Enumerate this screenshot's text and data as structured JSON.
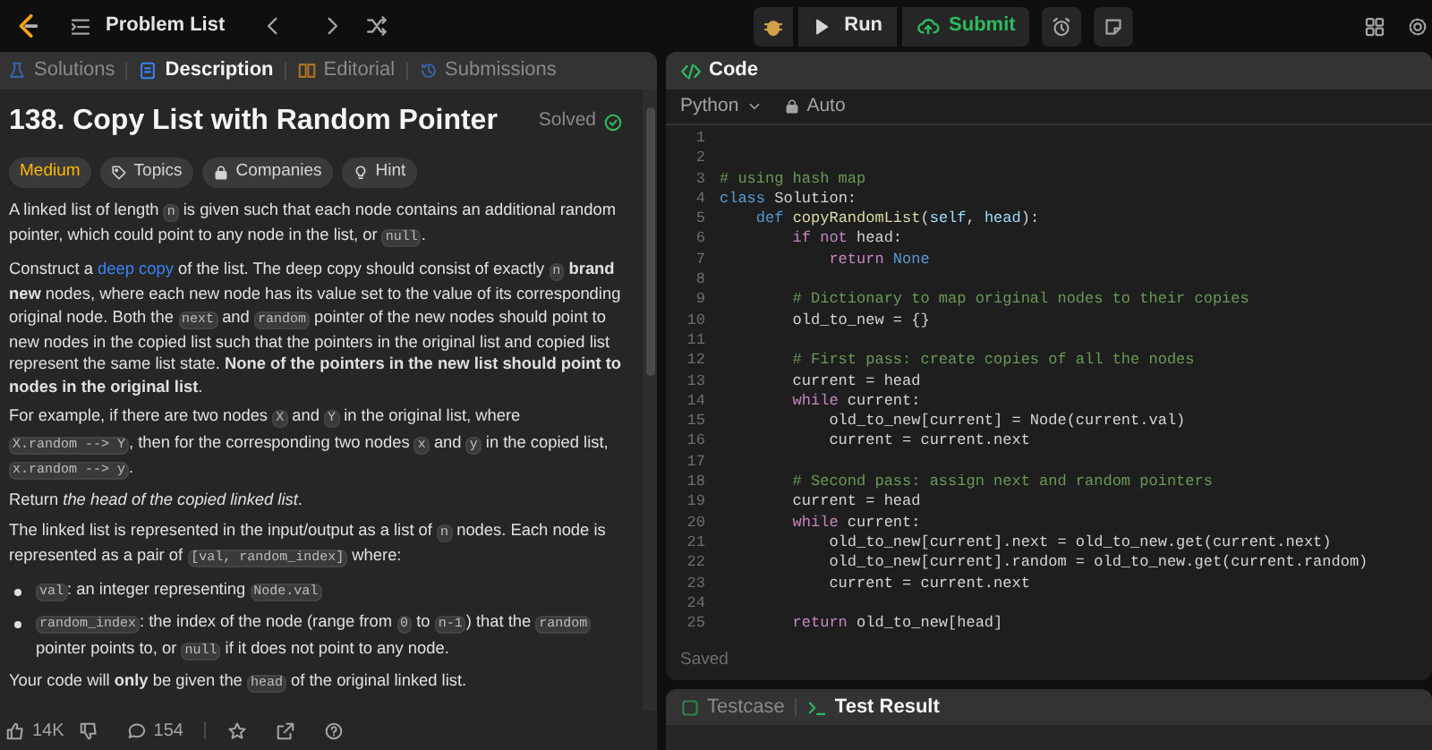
{
  "topbar": {
    "nav_label": "Problem List",
    "run_label": "Run",
    "submit_label": "Submit"
  },
  "left_tabs": [
    {
      "label": "Solutions",
      "selected": false
    },
    {
      "label": "Description",
      "selected": true
    },
    {
      "label": "Editorial",
      "selected": false
    },
    {
      "label": "Submissions",
      "selected": false
    }
  ],
  "problem": {
    "title": "138. Copy List with Random Pointer",
    "status": "Solved",
    "tags": [
      {
        "label": "Medium",
        "kind": "difficulty"
      },
      {
        "label": "Topics",
        "kind": "topics"
      },
      {
        "label": "Companies",
        "kind": "companies"
      },
      {
        "label": "Hint",
        "kind": "hint"
      }
    ],
    "blocks": [
      {
        "kind": "para",
        "segments": [
          {
            "kind": "text",
            "text": "A linked list of length "
          },
          {
            "kind": "code",
            "text": "n"
          },
          {
            "kind": "text",
            "text": " is given such that each node contains an additional random pointer, which could point to any node in the list, or "
          },
          {
            "kind": "code",
            "text": "null"
          },
          {
            "kind": "text",
            "text": "."
          }
        ]
      },
      {
        "kind": "para",
        "segments": [
          {
            "kind": "text",
            "text": "Construct a "
          },
          {
            "kind": "link",
            "text": "deep copy"
          },
          {
            "kind": "text",
            "text": " of the list. The deep copy should consist of exactly "
          },
          {
            "kind": "code",
            "text": "n"
          },
          {
            "kind": "text",
            "text": " **brand new** nodes, where each new node has its value set to the value of its corresponding original node. Both the "
          },
          {
            "kind": "code",
            "text": "next"
          },
          {
            "kind": "text",
            "text": " and "
          },
          {
            "kind": "code",
            "text": "random"
          },
          {
            "kind": "text",
            "text": " pointer of the new nodes should point to new nodes in the copied list such that the pointers in the original list and copied list represent the same list state. **None of the pointers in the new list should point to nodes in the original list**."
          }
        ]
      },
      {
        "kind": "para",
        "segments": [
          {
            "kind": "text",
            "text": "For example, if there are two nodes "
          },
          {
            "kind": "code",
            "text": "X"
          },
          {
            "kind": "text",
            "text": " and "
          },
          {
            "kind": "code",
            "text": "Y"
          },
          {
            "kind": "text",
            "text": " in the original list, where "
          },
          {
            "kind": "code",
            "text": "X.random --> Y"
          },
          {
            "kind": "text",
            "text": ", then for the corresponding two nodes "
          },
          {
            "kind": "code",
            "text": "x"
          },
          {
            "kind": "text",
            "text": " and "
          },
          {
            "kind": "code",
            "text": "y"
          },
          {
            "kind": "text",
            "text": " in the copied list, "
          },
          {
            "kind": "code",
            "text": "x.random --> y"
          },
          {
            "kind": "text",
            "text": "."
          }
        ]
      },
      {
        "kind": "para",
        "segments": [
          {
            "kind": "text",
            "text": "Return *the head of the copied linked list*."
          }
        ]
      },
      {
        "kind": "para",
        "segments": [
          {
            "kind": "text",
            "text": "The linked list is represented in the input/output as a list of "
          },
          {
            "kind": "code",
            "text": "n"
          },
          {
            "kind": "text",
            "text": " nodes. Each node is represented as a pair of "
          },
          {
            "kind": "code",
            "text": "[val, random_index]"
          },
          {
            "kind": "text",
            "text": " where:"
          }
        ]
      },
      {
        "kind": "bullet",
        "segments": [
          {
            "kind": "code",
            "text": "val"
          },
          {
            "kind": "text",
            "text": ": an integer representing "
          },
          {
            "kind": "code",
            "text": "Node.val"
          }
        ]
      },
      {
        "kind": "bullet",
        "segments": [
          {
            "kind": "code",
            "text": "random_index"
          },
          {
            "kind": "text",
            "text": ": the index of the node (range from "
          },
          {
            "kind": "code",
            "text": "0"
          },
          {
            "kind": "text",
            "text": " to "
          },
          {
            "kind": "code",
            "text": "n-1"
          },
          {
            "kind": "text",
            "text": ") that the "
          },
          {
            "kind": "code",
            "text": "random"
          },
          {
            "kind": "text",
            "text": " pointer points to, or "
          },
          {
            "kind": "code",
            "text": "null"
          },
          {
            "kind": "text",
            "text": " if it does not point to any node."
          }
        ]
      },
      {
        "kind": "para",
        "segments": [
          {
            "kind": "text",
            "text": "Your code will **only** be given the "
          },
          {
            "kind": "code",
            "text": "head"
          },
          {
            "kind": "text",
            "text": " of the original linked list."
          }
        ]
      }
    ]
  },
  "actions": {
    "likes": "14K",
    "comments": "154"
  },
  "editor": {
    "title": "Code",
    "language": "Python",
    "mode": "Auto",
    "footer": "Saved",
    "lines": [
      {
        "number": "1"
      },
      {
        "number": "2"
      },
      {
        "number": "3",
        "tokens": [
          {
            "kind": "comment",
            "text": "# using hash map"
          }
        ]
      },
      {
        "number": "4",
        "tokens": [
          {
            "kind": "storage",
            "text": "class"
          },
          {
            "kind": "plain",
            "text": " Solution:"
          }
        ]
      },
      {
        "number": "5",
        "tokens": [
          {
            "kind": "storage",
            "text": "    def"
          },
          {
            "kind": "function",
            "text": " copyRandomList"
          },
          {
            "kind": "plain",
            "text": "("
          },
          {
            "kind": "param",
            "text": "self"
          },
          {
            "kind": "plain",
            "text": ", "
          },
          {
            "kind": "param",
            "text": "head"
          },
          {
            "kind": "plain",
            "text": "):"
          }
        ]
      },
      {
        "number": "6",
        "tokens": [
          {
            "kind": "keyword",
            "text": "        if not"
          },
          {
            "kind": "plain",
            "text": " head:"
          }
        ]
      },
      {
        "number": "7",
        "tokens": [
          {
            "kind": "keyword",
            "text": "            return"
          },
          {
            "kind": "storage",
            "text": " None"
          }
        ]
      },
      {
        "number": "8"
      },
      {
        "number": "9",
        "tokens": [
          {
            "kind": "comment",
            "text": "        # Dictionary to map original nodes to their copies"
          }
        ]
      },
      {
        "number": "10",
        "tokens": [
          {
            "kind": "plain",
            "text": "        old_to_new = {}"
          }
        ]
      },
      {
        "number": "11"
      },
      {
        "number": "12",
        "tokens": [
          {
            "kind": "comment",
            "text": "        # First pass: create copies of all the nodes"
          }
        ]
      },
      {
        "number": "13",
        "tokens": [
          {
            "kind": "plain",
            "text": "        current = head"
          }
        ]
      },
      {
        "number": "14",
        "tokens": [
          {
            "kind": "keyword",
            "text": "        while"
          },
          {
            "kind": "plain",
            "text": " current:"
          }
        ]
      },
      {
        "number": "15",
        "tokens": [
          {
            "kind": "plain",
            "text": "            old_to_new[current] = Node(current.val)"
          }
        ]
      },
      {
        "number": "16",
        "tokens": [
          {
            "kind": "plain",
            "text": "            current = current.next"
          }
        ]
      },
      {
        "number": "17"
      },
      {
        "number": "18",
        "tokens": [
          {
            "kind": "comment",
            "text": "        # Second pass: assign next and random pointers"
          }
        ]
      },
      {
        "number": "19",
        "tokens": [
          {
            "kind": "plain",
            "text": "        current = head"
          }
        ]
      },
      {
        "number": "20",
        "tokens": [
          {
            "kind": "keyword",
            "text": "        while"
          },
          {
            "kind": "plain",
            "text": " current:"
          }
        ]
      },
      {
        "number": "21",
        "tokens": [
          {
            "kind": "plain",
            "text": "            old_to_new[current].next = old_to_new.get(current.next)"
          }
        ]
      },
      {
        "number": "22",
        "tokens": [
          {
            "kind": "plain",
            "text": "            old_to_new[current].random = old_to_new.get(current.random)"
          }
        ]
      },
      {
        "number": "23",
        "tokens": [
          {
            "kind": "plain",
            "text": "            current = current.next"
          }
        ]
      },
      {
        "number": "24"
      },
      {
        "number": "25",
        "tokens": [
          {
            "kind": "keyword",
            "text": "        return"
          },
          {
            "kind": "plain",
            "text": " old_to_new[head]"
          }
        ]
      }
    ]
  },
  "bottom_tabs": [
    {
      "label": "Testcase",
      "selected": false
    },
    {
      "label": "Test Result",
      "selected": true
    }
  ]
}
